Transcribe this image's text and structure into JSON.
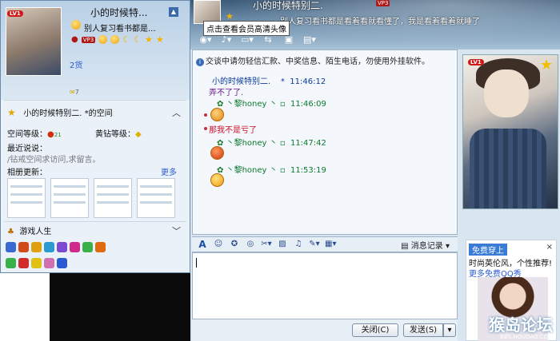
{
  "chat": {
    "friend_name": "小的时候特别二.",
    "friend_signature": "别人复习看书都是看着看就看懂了，我是看着看着就睡了",
    "friend_vip": "VP3",
    "avatar_tooltip": "点击查看会员高清头像",
    "warning": "交谈中请勿轻信汇款、中奖信息、陌生电话，勿使用外挂软件。",
    "messages": [
      {
        "name": "小的时候特别二.",
        "time": "11:46:12"
      },
      {
        "text": "弄不了了."
      },
      {
        "name": "丶黎honey 丶",
        "time": "11:46:09"
      },
      {
        "text": "那我不是亏了"
      },
      {
        "name": "丶黎honey 丶",
        "time": "11:47:42"
      },
      {
        "name": "丶黎honey 丶",
        "time": "11:53:19"
      }
    ],
    "right_level": "LV1",
    "message_log": "消息记录",
    "close_button": "关闭(C)",
    "send_button": "发送(S)",
    "ad": {
      "tag": "免费穿上",
      "close": "×",
      "line1": "时尚英伦风，个性推荐!",
      "line2": "更多免费QQ秀",
      "watermark": "猴岛论坛",
      "watermark_url": "BBS.HOUDAO.COM"
    }
  },
  "card": {
    "level_badge": "LV1",
    "nickname": "小的时候特...",
    "signature": "别人复习看书都是...",
    "vip": "VP3",
    "level_text": "2货",
    "mail_count": "7",
    "space_title": "小的时候特别二.  *的空间",
    "space_level_label": "空间等级：",
    "space_level_value": "21",
    "yellow_diamond_label": "黄钻等级：",
    "recent_label": "最近说说：",
    "recent_text": "/钻戒空间求访问,求留言。",
    "album_label": "相册更新：",
    "more": "更多",
    "game_label": "游戏人生"
  }
}
